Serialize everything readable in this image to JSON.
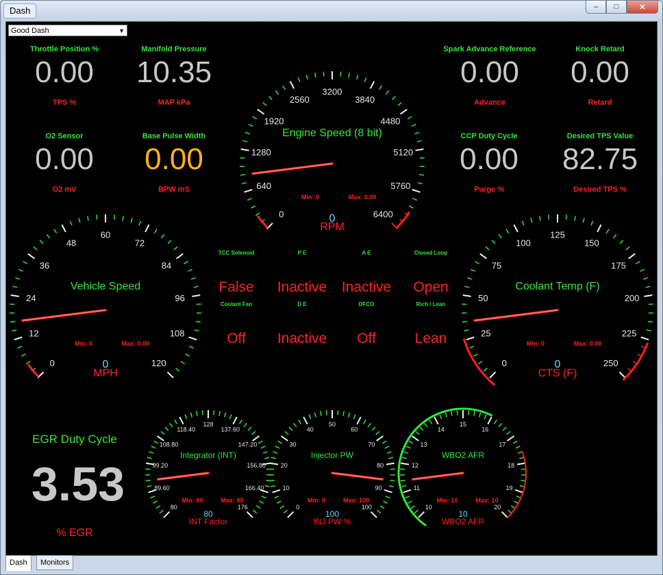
{
  "window": {
    "title": "Dash",
    "buttons": {
      "minimize": "‒",
      "maximize": "□",
      "close": "✕"
    }
  },
  "dashboard_select": {
    "selected": "Good Dash"
  },
  "tabs": [
    {
      "label": "Dash",
      "active": true
    },
    {
      "label": "Monitors",
      "active": false
    }
  ],
  "digital": {
    "tps": {
      "title": "Throttle Position %",
      "value": "0.00",
      "unit": "TPS %"
    },
    "map": {
      "title": "Manifold Pressure",
      "value": "10.35",
      "unit": "MAP kPa"
    },
    "spark": {
      "title": "Spark Advance Reference",
      "value": "0.00",
      "unit": "Advance"
    },
    "knock": {
      "title": "Knock Retard",
      "value": "0.00",
      "unit": "Retard"
    },
    "o2": {
      "title": "O2 Sensor",
      "value": "0.00",
      "unit": "O2 mV"
    },
    "bpw": {
      "title": "Base Pulse Width",
      "value": "0.00",
      "unit": "BPW mS"
    },
    "ccp": {
      "title": "CCP Duty Cycle",
      "value": "0.00",
      "unit": "Purge %"
    },
    "dtps": {
      "title": "Desired TPS Value",
      "value": "82.75",
      "unit": "Desired TPS %"
    }
  },
  "indicators": [
    {
      "label": "TCC Solenoid",
      "value": "False"
    },
    {
      "label": "P E",
      "value": "Inactive"
    },
    {
      "label": "A E",
      "value": "Inactive"
    },
    {
      "label": "Closed Loop",
      "value": "Open"
    },
    {
      "label": "Coolant Fan",
      "value": "Off"
    },
    {
      "label": "D E",
      "value": "Inactive"
    },
    {
      "label": "DFCO",
      "value": "Off"
    },
    {
      "label": "Rich / Lean",
      "value": "Lean"
    }
  ],
  "egr": {
    "title": "EGR Duty Cycle",
    "value": "3.53",
    "unit": "% EGR"
  },
  "gauges": {
    "rpm": {
      "title": "Engine Speed (8 bit)",
      "unit": "RPM",
      "current": "0",
      "min_label": "Min: 0",
      "max_label": "Max: 0.00",
      "ticks": [
        "0",
        "640",
        "1280",
        "1920",
        "2560",
        "3200",
        "3840",
        "4480",
        "5120",
        "5760",
        "6400"
      ],
      "needle_fraction": 0.14
    },
    "mph": {
      "title": "Vehicle Speed",
      "unit": "MPH",
      "current": "0",
      "min_label": "Min: 0",
      "max_label": "Max: 0.00",
      "ticks": [
        "0",
        "12",
        "24",
        "36",
        "48",
        "60",
        "72",
        "84",
        "96",
        "108",
        "120"
      ],
      "needle_fraction": 0.14
    },
    "cts": {
      "title": "Coolant Temp (F)",
      "unit": "CTS (F)",
      "current": "0",
      "min_label": "Min: 0",
      "max_label": "Max: 0.00",
      "ticks": [
        "0",
        "25",
        "50",
        "75",
        "100",
        "125",
        "150",
        "175",
        "200",
        "225",
        "250"
      ],
      "needle_fraction": 0.14
    },
    "int": {
      "title": "Integrator (INT)",
      "unit": "INT Factor",
      "current": "80",
      "min_label": "Min: 80",
      "max_label": "Max: 80",
      "ticks": [
        "80",
        "89.60",
        "99.20",
        "108.80",
        "118.40",
        "128",
        "137.60",
        "147.20",
        "156.80",
        "166.40",
        "176"
      ],
      "needle_fraction": 0.14
    },
    "injpw": {
      "title": "Injector PW",
      "unit": "INJ PW %",
      "current": "100",
      "min_label": "Min: 0",
      "max_label": "Max: 100",
      "ticks": [
        "0",
        "10",
        "20",
        "30",
        "40",
        "50",
        "60",
        "70",
        "80",
        "90",
        "100"
      ],
      "needle_fraction": 0.86
    },
    "afr": {
      "title": "WBO2 AFR",
      "unit": "WBO2 AFR",
      "current": "10",
      "min_label": "Min: 10",
      "max_label": "Max: 10",
      "ticks": [
        "10",
        "11",
        "12",
        "13",
        "14",
        "15",
        "16",
        "17",
        "18",
        "19",
        "20"
      ],
      "needle_fraction": 0.14
    }
  },
  "colors": {
    "title_green": "#33e63a",
    "alert_red": "#ff2020",
    "value_gray": "#c8c8c8",
    "highlight_orange": "#ffb316",
    "current_cyan": "#64d7ff"
  }
}
